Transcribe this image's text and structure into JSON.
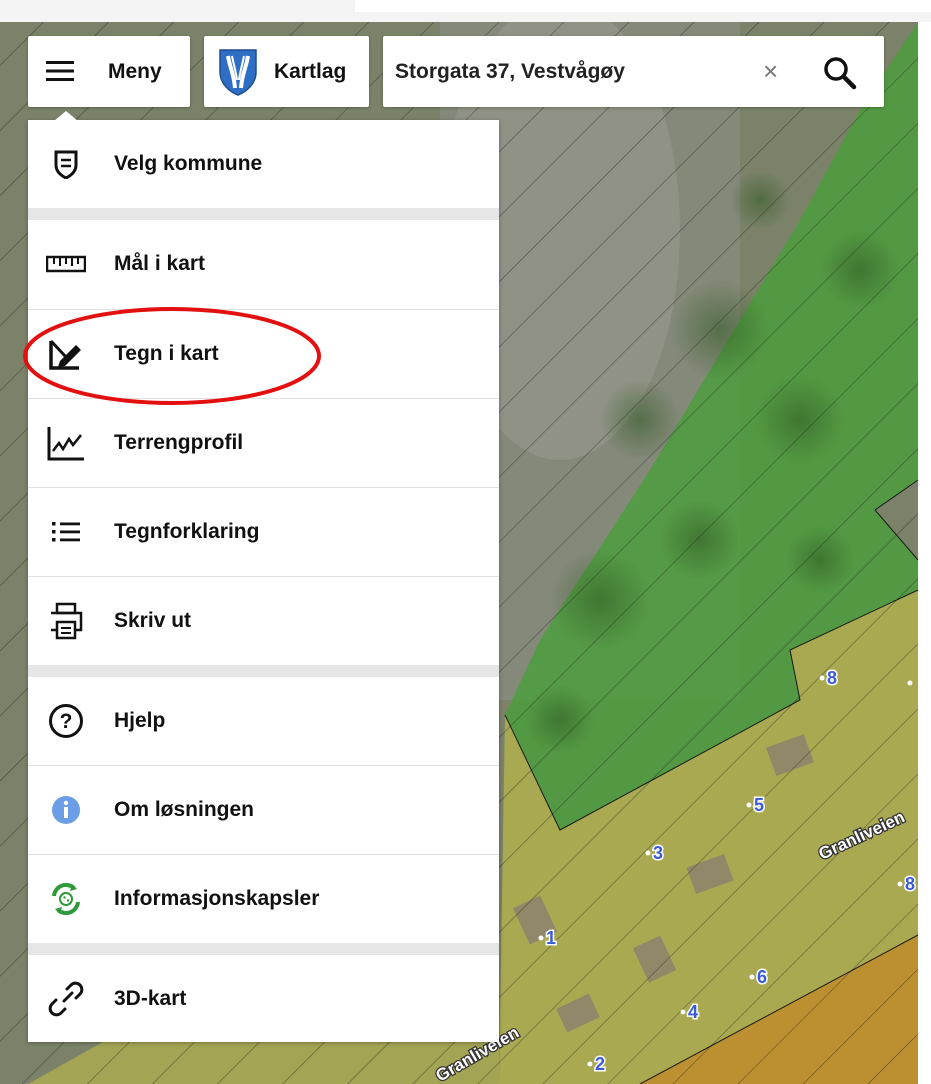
{
  "toolbar": {
    "menu_label": "Meny",
    "layers_label": "Kartlag",
    "search_value": "Storgata 37, Vestvågøy",
    "clear_symbol": "×"
  },
  "menu": {
    "items": [
      {
        "label": "Velg kommune",
        "icon": "municipality-icon"
      },
      {
        "label": "Mål i kart",
        "icon": "ruler-icon"
      },
      {
        "label": "Tegn i kart",
        "icon": "draw-icon"
      },
      {
        "label": "Terrengprofil",
        "icon": "terrain-profile-icon"
      },
      {
        "label": "Tegnforklaring",
        "icon": "legend-list-icon"
      },
      {
        "label": "Skriv ut",
        "icon": "printer-icon"
      },
      {
        "label": "Hjelp",
        "icon": "help-icon"
      },
      {
        "label": "Om løsningen",
        "icon": "info-icon"
      },
      {
        "label": "Informasjonskapsler",
        "icon": "cookie-consent-icon"
      },
      {
        "label": "3D-kart",
        "icon": "link-icon"
      }
    ]
  },
  "map": {
    "street_labels": [
      "Granliveien",
      "Granliveien"
    ],
    "address_numbers": [
      "8",
      "5",
      "3",
      "8",
      "1",
      "6",
      "4",
      "2"
    ]
  },
  "colors": {
    "highlight_circle": "#e41010",
    "zone_green": "#4c9e3d",
    "zone_yellow": "#b5b34c",
    "zone_orange": "#c08b2c",
    "number_label": "#3b5bd9"
  }
}
